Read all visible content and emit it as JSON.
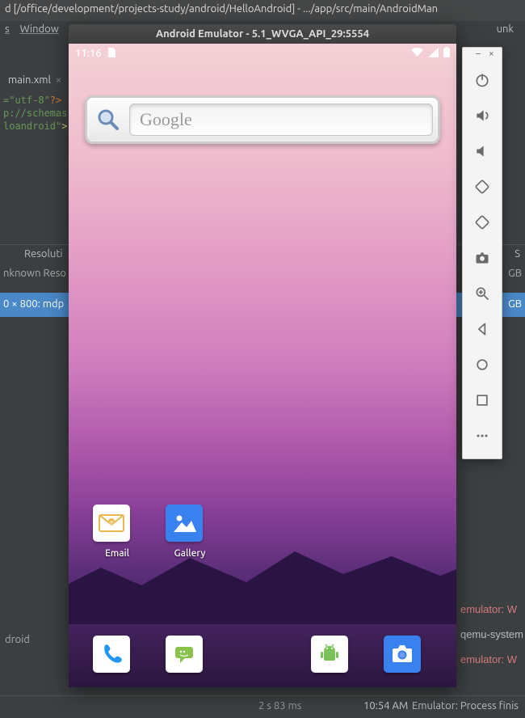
{
  "ide": {
    "title": "d [/office/development/projects-study/android/HelloAndroid] - .../app/src/main/AndroidMan",
    "menus": [
      "s",
      "Window"
    ],
    "editor_tab": "main.xml",
    "code": {
      "l1a": "=\"utf-8\"",
      "l1b": "?>",
      "l2": "p://schemas.",
      "l3a": "loandroid\"",
      "l3b": ">"
    },
    "panel_left": "Resoluti",
    "panel_right": "S",
    "row1_left": "nknown Reso",
    "row1_right": "GB",
    "rowsel_left": "0 × 800: mdp",
    "rowsel_right": "GB",
    "menu_right_1": "unk",
    "log_left_1": "droid",
    "log_right": [
      "emulator: W",
      "qemu-system",
      "emulator: W"
    ],
    "status_time1": "2 s 83 ms",
    "status_time2": "10:54 AM",
    "status_msg": "Emulator: Process finis"
  },
  "emulator": {
    "title": "Android Emulator - 5.1_WVGA_API_29:5554",
    "clock": "11:16",
    "search_placeholder": "Google",
    "apps": {
      "email": "Email",
      "gallery": "Gallery"
    }
  },
  "sidebar": {
    "buttons": [
      "power-icon",
      "volume-up-icon",
      "volume-down-icon",
      "rotate-left-icon",
      "rotate-right-icon",
      "camera-icon",
      "zoom-in-icon",
      "back-icon",
      "home-icon",
      "overview-icon",
      "more-icon"
    ]
  }
}
